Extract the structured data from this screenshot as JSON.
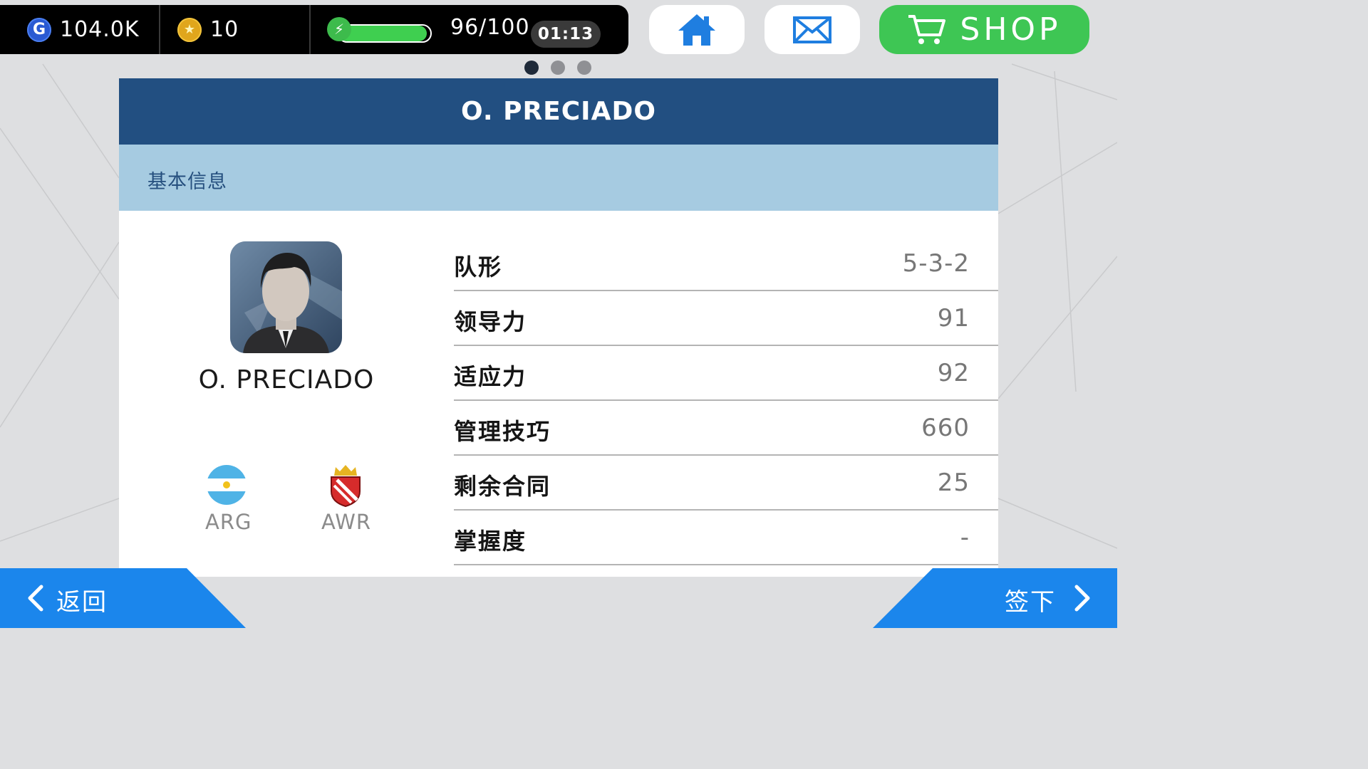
{
  "topbar": {
    "gp_value": "104.0K",
    "coin_value": "10",
    "energy_text": "96/100",
    "energy_fraction": 0.96,
    "timer": "01:13"
  },
  "icons": {
    "gp": "gp-currency-icon",
    "coin": "coin-icon",
    "energy": "energy-bolt-icon",
    "home": "home-icon",
    "mail": "mail-icon",
    "cart": "cart-icon"
  },
  "shop_label": "SHOP",
  "page_dots": {
    "count": 3,
    "active": 0
  },
  "card": {
    "header_title": "O. PRECIADO",
    "section_title": "基本信息",
    "player_name": "O. PRECIADO",
    "nationality": "ARG",
    "club": "AWR",
    "stats": [
      {
        "label": "队形",
        "value": "5-3-2"
      },
      {
        "label": "领导力",
        "value": "91"
      },
      {
        "label": "适应力",
        "value": "92"
      },
      {
        "label": "管理技巧",
        "value": "660"
      },
      {
        "label": "剩余合同",
        "value": "25"
      },
      {
        "label": "掌握度",
        "value": "-"
      }
    ]
  },
  "nav": {
    "back_label": "返回",
    "next_label": "签下"
  },
  "colors": {
    "header_blue": "#224f81",
    "section_blue": "#a6cbe1",
    "shop_green": "#3ec654",
    "nav_blue": "#1b86ec"
  }
}
